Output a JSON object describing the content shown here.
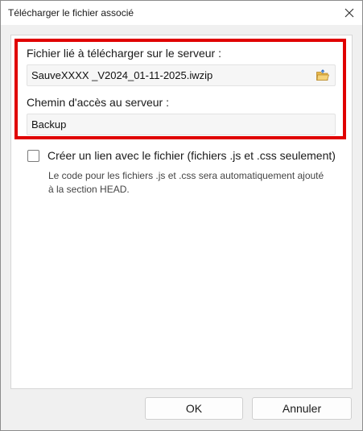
{
  "window": {
    "title": "Télécharger le fichier associé"
  },
  "form": {
    "file_label": "Fichier lié à télécharger sur le serveur :",
    "file_value": "SauveXXXX _V2024_01-11-2025.iwzip",
    "path_label": "Chemin d'accès au serveur :",
    "path_value": "Backup",
    "link_checkbox_label": "Créer un lien avec le fichier (fichiers .js et .css seulement)",
    "link_checkbox_checked": false,
    "hint_text": "Le code pour les fichiers .js et .css sera automatiquement ajouté à la section HEAD."
  },
  "buttons": {
    "ok": "OK",
    "cancel": "Annuler"
  },
  "icons": {
    "close": "close-icon",
    "browse": "folder-open-icon"
  },
  "colors": {
    "highlight": "#e00000",
    "panel": "#ffffff",
    "background": "#f0f0f0"
  }
}
